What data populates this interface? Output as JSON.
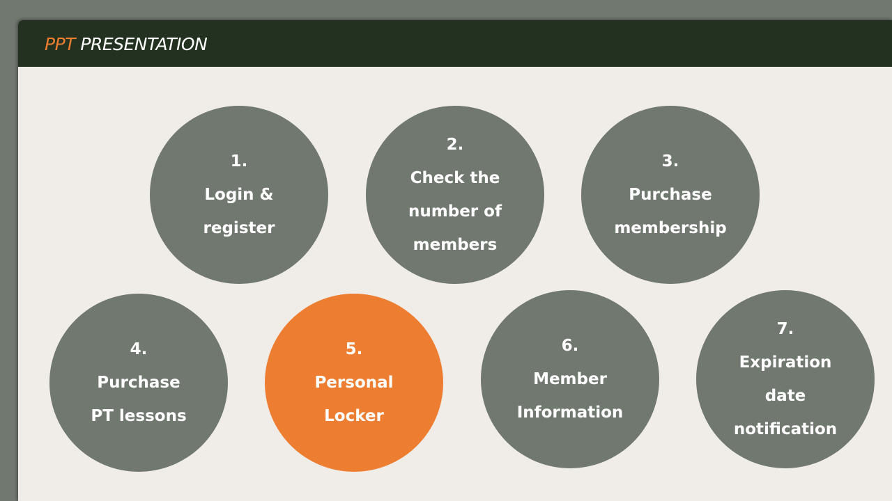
{
  "header": {
    "title_accent": "PPT",
    "title_main": "PRESENTATION"
  },
  "colors": {
    "frame": "#717870",
    "title_bar": "#233220",
    "accent": "#ed7d31",
    "slide_bg": "#f0ede8",
    "circle_default": "#717870",
    "circle_highlight": "#ed7d31",
    "text_light": "#ffffff"
  },
  "items": [
    {
      "number": "1.",
      "lines": [
        "Login &",
        "register"
      ],
      "highlighted": false
    },
    {
      "number": "2.",
      "lines": [
        "Check the",
        "number of",
        "members"
      ],
      "highlighted": false
    },
    {
      "number": "3.",
      "lines": [
        "Purchase",
        "membership"
      ],
      "highlighted": false
    },
    {
      "number": "4.",
      "lines": [
        "Purchase",
        "PT lessons"
      ],
      "highlighted": false
    },
    {
      "number": "5.",
      "lines": [
        "Personal",
        "Locker"
      ],
      "highlighted": true
    },
    {
      "number": "6.",
      "lines": [
        "Member",
        "Information"
      ],
      "highlighted": false
    },
    {
      "number": "7.",
      "lines": [
        "Expiration",
        "date",
        "notification"
      ],
      "highlighted": false
    }
  ]
}
